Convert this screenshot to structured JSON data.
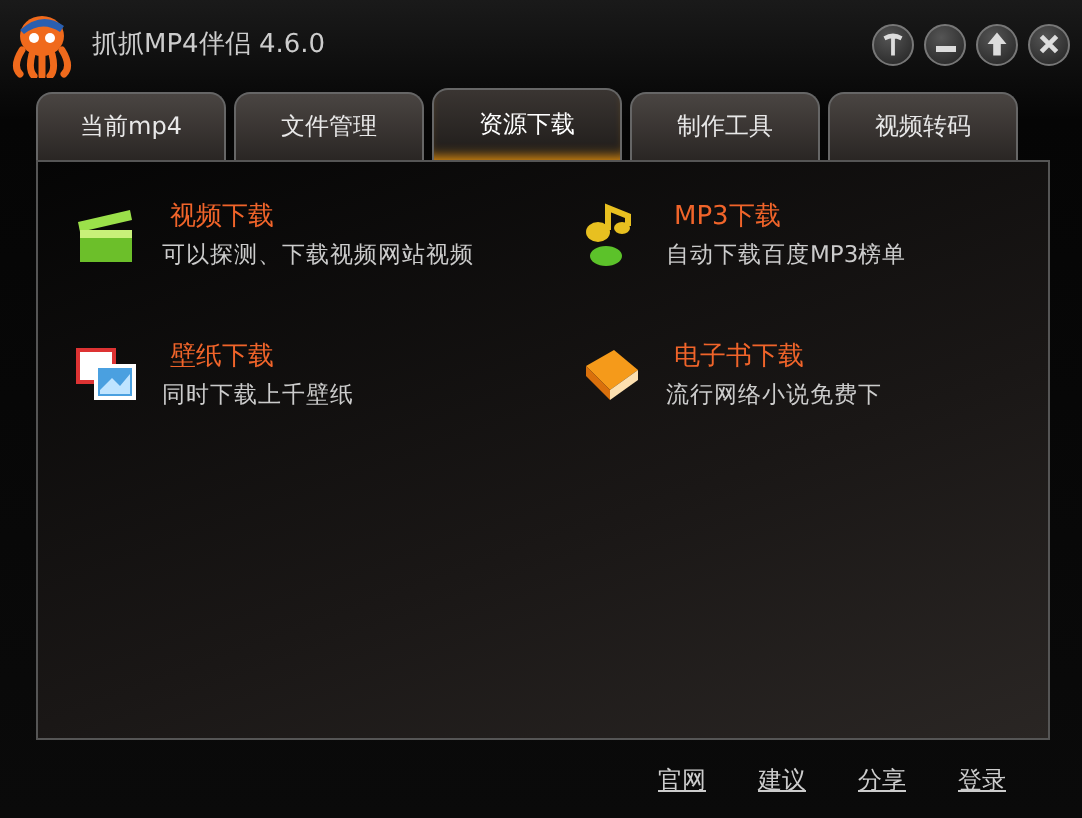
{
  "window": {
    "title": "抓抓MP4伴侣 4.6.0"
  },
  "tabs": [
    {
      "label": "当前mp4",
      "selected": false
    },
    {
      "label": "文件管理",
      "selected": false
    },
    {
      "label": "资源下载",
      "selected": true
    },
    {
      "label": "制作工具",
      "selected": false
    },
    {
      "label": "视频转码",
      "selected": false
    }
  ],
  "features": [
    {
      "kind": "video",
      "title": "视频下载",
      "description": "可以探测、下载视频网站视频"
    },
    {
      "kind": "music",
      "title": "MP3下载",
      "description": "自动下载百度MP3榜单"
    },
    {
      "kind": "wallpaper",
      "title": "壁纸下载",
      "description": "同时下载上千壁纸"
    },
    {
      "kind": "ebook",
      "title": "电子书下载",
      "description": "流行网络小说免费下"
    }
  ],
  "footer_links": [
    "官网",
    "建议",
    "分享",
    "登录"
  ]
}
